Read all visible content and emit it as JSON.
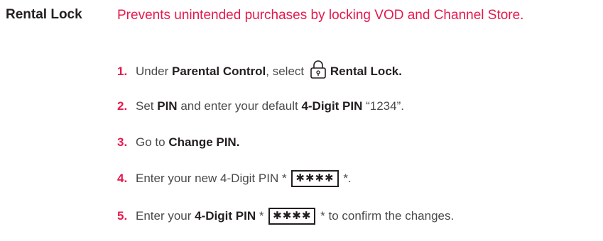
{
  "term": "Rental Lock",
  "description": "Prevents unintended purchases by locking VOD and Channel Store.",
  "steps": [
    {
      "num": "1.",
      "a": "Under ",
      "b": "Parental Control",
      "c": ", select ",
      "d": "Rental Lock.",
      "icon": "lock-icon"
    },
    {
      "num": "2.",
      "a": "Set ",
      "b": "PIN",
      "c": " and enter your default ",
      "d": "4-Digit PIN",
      "e": " “1234”."
    },
    {
      "num": "3.",
      "a": "Go to ",
      "b": "Change PIN."
    },
    {
      "num": "4.",
      "a": "Enter your new 4-Digit PIN * ",
      "pin": "✱✱✱✱",
      "c": " *."
    },
    {
      "num": "5.",
      "a": "Enter your ",
      "b": "4-Digit PIN",
      "c": " * ",
      "pin": "✱✱✱✱",
      "d": " * to confirm the changes."
    }
  ],
  "colors": {
    "accent": "#e5194b",
    "text": "#4a4a4a",
    "bold": "#231f20"
  }
}
